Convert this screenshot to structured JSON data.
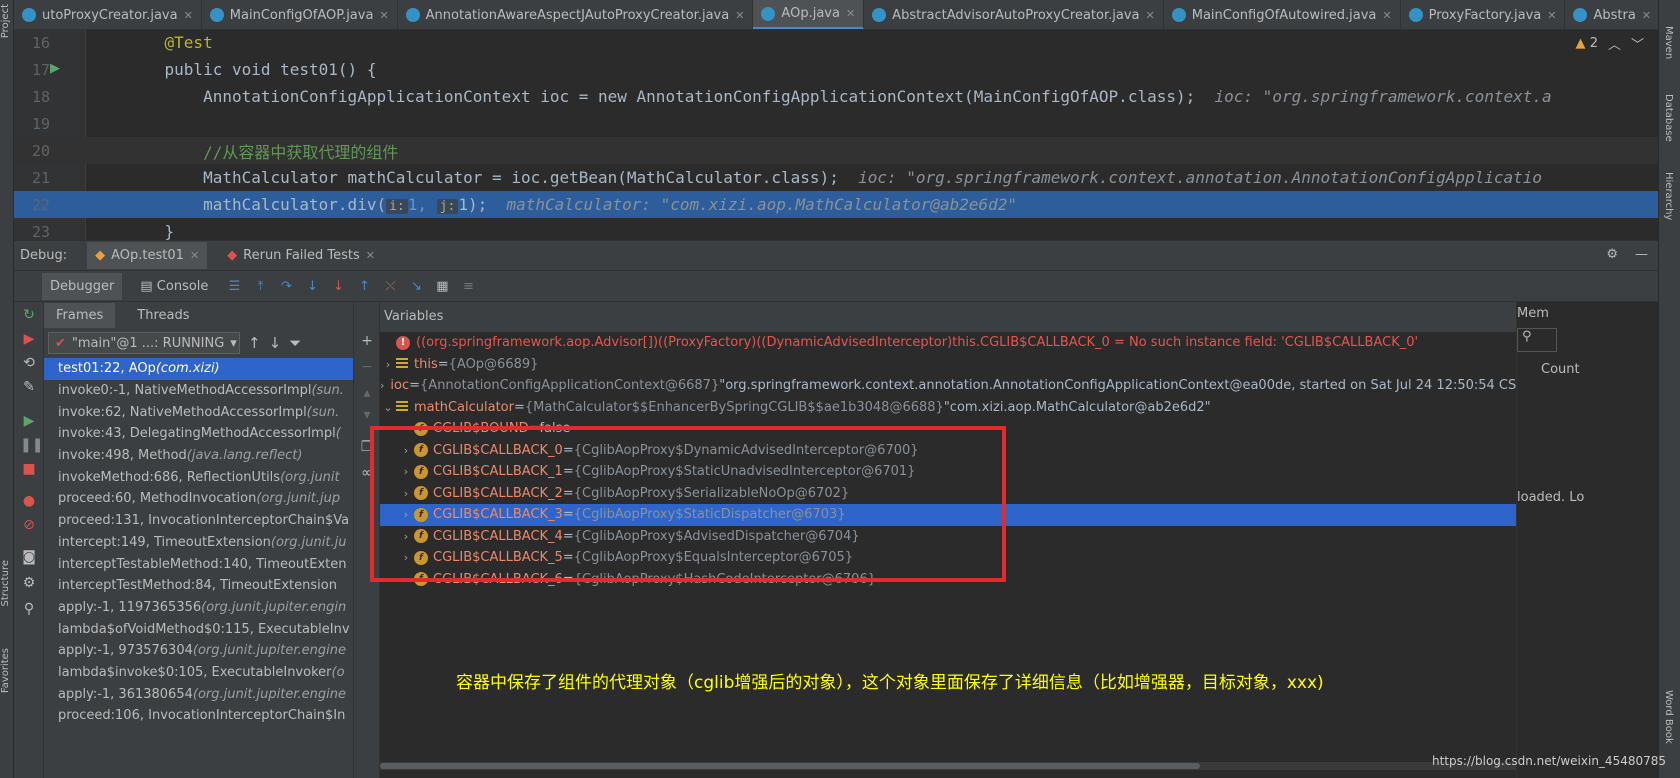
{
  "tabs": [
    {
      "label": "utoProxyCreator.java",
      "active": false
    },
    {
      "label": "MainConfigOfAOP.java",
      "active": false
    },
    {
      "label": "AnnotationAwareAspectJAutoProxyCreator.java",
      "active": false
    },
    {
      "label": "AOp.java",
      "active": true
    },
    {
      "label": "AbstractAdvisorAutoProxyCreator.java",
      "active": false
    },
    {
      "label": "MainConfigOfAutowired.java",
      "active": false
    },
    {
      "label": "ProxyFactory.java",
      "active": false
    },
    {
      "label": "Abstra",
      "active": false
    }
  ],
  "left_stripe": {
    "project": "Project",
    "structure": "Structure",
    "favorites": "Favorites"
  },
  "right_stripe": {
    "maven": "Maven",
    "database": "Database",
    "hierarchy": "Hierarchy",
    "wordbook": "Word Book"
  },
  "editor": {
    "warnings": "2",
    "lines": [
      {
        "n": "16",
        "code": "    @Test"
      },
      {
        "n": "17",
        "code": "    public void test01() {"
      },
      {
        "n": "18",
        "code": "        AnnotationConfigApplicationContext ioc = new AnnotationConfigApplicationContext(MainConfigOfAOP.class);",
        "hint": "  ioc: \"org.springframework.context.a"
      },
      {
        "n": "19",
        "code": ""
      },
      {
        "n": "20",
        "code": "        //从容器中获取代理的组件"
      },
      {
        "n": "21",
        "code": "        MathCalculator mathCalculator = ioc.getBean(MathCalculator.class);",
        "hint": "  ioc: \"org.springframework.context.annotation.AnnotationConfigApplicatio"
      },
      {
        "n": "22",
        "code_prefix": "        mathCalculator.div(",
        "p1": "i:",
        "a1": "1, ",
        "p2": "j:",
        "a2": "1);",
        "hint": "  mathCalculator: \"com.xizi.aop.MathCalculator@ab2e6d2\""
      },
      {
        "n": "23",
        "code": "    }"
      }
    ]
  },
  "debug_header": {
    "label": "Debug:",
    "session": "AOp.test01",
    "rerun": "Rerun Failed Tests"
  },
  "toolbar": {
    "debugger": "Debugger",
    "console": "Console"
  },
  "frames_panel": {
    "frames_tab": "Frames",
    "threads_tab": "Threads",
    "thread": "\"main\"@1 ...: RUNNING",
    "frames": [
      {
        "m": "test01:22, AOp ",
        "p": "(com.xizi)"
      },
      {
        "m": "invoke0:-1, NativeMethodAccessorImpl ",
        "p": "(sun."
      },
      {
        "m": "invoke:62, NativeMethodAccessorImpl ",
        "p": "(sun."
      },
      {
        "m": "invoke:43, DelegatingMethodAccessorImpl ",
        "p": "("
      },
      {
        "m": "invoke:498, Method ",
        "p": "(java.lang.reflect)"
      },
      {
        "m": "invokeMethod:686, ReflectionUtils ",
        "p": "(org.junit"
      },
      {
        "m": "proceed:60, MethodInvocation ",
        "p": "(org.junit.jup"
      },
      {
        "m": "proceed:131, InvocationInterceptorChain$Va",
        "p": ""
      },
      {
        "m": "intercept:149, TimeoutExtension ",
        "p": "(org.junit.ju"
      },
      {
        "m": "interceptTestableMethod:140, TimeoutExten",
        "p": ""
      },
      {
        "m": "interceptTestMethod:84, TimeoutExtension",
        "p": ""
      },
      {
        "m": "apply:-1, 1197365356 ",
        "p": "(org.junit.jupiter.engin"
      },
      {
        "m": "lambda$ofVoidMethod$0:115, ExecutableInv",
        "p": ""
      },
      {
        "m": "apply:-1, 973576304 ",
        "p": "(org.junit.jupiter.engine"
      },
      {
        "m": "lambda$invoke$0:105, ExecutableInvoker ",
        "p": "(o"
      },
      {
        "m": "apply:-1, 361380654 ",
        "p": "(org.junit.jupiter.engine"
      },
      {
        "m": "proceed:106, InvocationInterceptorChain$In",
        "p": ""
      }
    ]
  },
  "variables_panel": {
    "title": "Variables",
    "error_row": "((org.springframework.aop.Advisor[])((ProxyFactory)((DynamicAdvisedInterceptor)this.CGLIB$CALLBACK_0 = No such instance field: 'CGLIB$CALLBACK_0'",
    "rows": [
      {
        "name": "this",
        "eq": " = ",
        "type": "{AOp@6689}",
        "val": "",
        "kind": "list"
      },
      {
        "name": "ioc",
        "eq": " = ",
        "type": "{AnnotationConfigApplicationContext@6687}",
        "val": " \"org.springframework.context.annotation.AnnotationConfigApplicationContext@ea00de, started on Sat Jul 24 12:50:54 CST 2021\"",
        "kind": "list"
      },
      {
        "name": "mathCalculator",
        "eq": " = ",
        "type": "{MathCalculator$$EnhancerBySpringCGLIB$$ae1b3048@6688}",
        "val": " \"com.xizi.aop.MathCalculator@ab2e6d2\"",
        "kind": "list-open"
      },
      {
        "name": "CGLIB$BOUND",
        "eq": " = ",
        "type": "",
        "val": "false",
        "kind": "field-leaf"
      },
      {
        "name": "CGLIB$CALLBACK_0",
        "eq": " = ",
        "type": "{CglibAopProxy$DynamicAdvisedInterceptor@6700}",
        "val": "",
        "kind": "field"
      },
      {
        "name": "CGLIB$CALLBACK_1",
        "eq": " = ",
        "type": "{CglibAopProxy$StaticUnadvisedInterceptor@6701}",
        "val": "",
        "kind": "field"
      },
      {
        "name": "CGLIB$CALLBACK_2",
        "eq": " = ",
        "type": "{CglibAopProxy$SerializableNoOp@6702}",
        "val": "",
        "kind": "field"
      },
      {
        "name": "CGLIB$CALLBACK_3",
        "eq": " = ",
        "type": "{CglibAopProxy$StaticDispatcher@6703}",
        "val": "",
        "kind": "field",
        "selected": true
      },
      {
        "name": "CGLIB$CALLBACK_4",
        "eq": " = ",
        "type": "{CglibAopProxy$AdvisedDispatcher@6704}",
        "val": "",
        "kind": "field"
      },
      {
        "name": "CGLIB$CALLBACK_5",
        "eq": " = ",
        "type": "{CglibAopProxy$EqualsInterceptor@6705}",
        "val": "",
        "kind": "field"
      },
      {
        "name": "CGLIB$CALLBACK_6",
        "eq": " = ",
        "type": "{CglibAopProxy$HashCodeInterceptor@6706}",
        "val": "",
        "kind": "field"
      }
    ]
  },
  "memory_panel": {
    "title": "Mem",
    "count": "Count",
    "loaded": "loaded. Lo"
  },
  "annotation": "容器中保存了组件的代理对象（cglib增强后的对象），这个对象里面保存了详细信息（比如增强器，目标对象，xxx)",
  "watermark": "https://blog.csdn.net/weixin_45480785",
  "colors": {
    "accent": "#2f65ca",
    "annotation_box": "#e02c2c",
    "caption": "#ffff00"
  }
}
